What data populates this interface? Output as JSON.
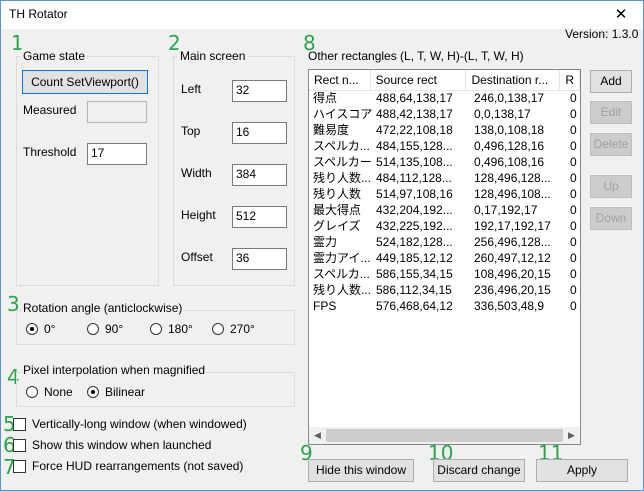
{
  "window": {
    "title": "TH Rotator",
    "close_label": "✕"
  },
  "version": "Version: 1.3.0",
  "annotations": [
    "1",
    "2",
    "8",
    "3",
    "4",
    "5",
    "6",
    "7",
    "9",
    "10",
    "11"
  ],
  "game_state": {
    "group_label": "Game state",
    "count_button": "Count SetViewport()",
    "measured_label": "Measured",
    "measured_value": "",
    "threshold_label": "Threshold",
    "threshold_value": "17"
  },
  "main_screen": {
    "group_label": "Main screen",
    "left_label": "Left",
    "left_value": "32",
    "top_label": "Top",
    "top_value": "16",
    "width_label": "Width",
    "width_value": "384",
    "height_label": "Height",
    "height_value": "512",
    "offset_label": "Offset",
    "offset_value": "36"
  },
  "other_rects": {
    "label": "Other rectangles (L, T, W, H)-(L, T, W, H)",
    "columns": [
      "Rect n...",
      "Source rect",
      "Destination r...",
      "R"
    ],
    "rows": [
      [
        "得点",
        "488,64,138,17",
        "246,0,138,17",
        "0"
      ],
      [
        "ハイスコア",
        "488,42,138,17",
        "0,0,138,17",
        "0"
      ],
      [
        "難易度",
        "472,22,108,18",
        "138,0,108,18",
        "0"
      ],
      [
        "スペルカ...",
        "484,155,128...",
        "0,496,128,16",
        "0"
      ],
      [
        "スペルカード",
        "514,135,108...",
        "0,496,108,16",
        "0"
      ],
      [
        "残り人数...",
        "484,112,128...",
        "128,496,128...",
        "0"
      ],
      [
        "残り人数",
        "514,97,108,16",
        "128,496,108...",
        "0"
      ],
      [
        "最大得点",
        "432,204,192...",
        "0,17,192,17",
        "0"
      ],
      [
        "グレイズ",
        "432,225,192...",
        "192,17,192,17",
        "0"
      ],
      [
        "霊力",
        "524,182,128...",
        "256,496,128...",
        "0"
      ],
      [
        "霊力アイ...",
        "449,185,12,12",
        "260,497,12,12",
        "0"
      ],
      [
        "スペルカ...",
        "586,155,34,15",
        "108,496,20,15",
        "0"
      ],
      [
        "残り人数...",
        "586,112,34,15",
        "236,496,20,15",
        "0"
      ],
      [
        "FPS",
        "576,468,64,12",
        "336,503,48,9",
        "0"
      ]
    ],
    "buttons": {
      "add": "Add",
      "edit": "Edit",
      "delete": "Delete",
      "up": "Up",
      "down": "Down"
    }
  },
  "rotation": {
    "group_label": "Rotation angle (anticlockwise)",
    "options": [
      "0°",
      "90°",
      "180°",
      "270°"
    ],
    "selected": "0°"
  },
  "interpolation": {
    "group_label": "Pixel interpolation when magnified",
    "options": [
      "None",
      "Bilinear"
    ],
    "selected": "Bilinear"
  },
  "checkboxes": {
    "vertical": "Vertically-long window (when windowed)",
    "show": "Show this window when launched",
    "force_hud": "Force HUD rearrangements (not saved)"
  },
  "bottom_buttons": {
    "hide": "Hide this window",
    "discard": "Discard change",
    "apply": "Apply"
  },
  "colors": {
    "annotation": "#2aa54a",
    "window_border": "#5a8fd0"
  }
}
